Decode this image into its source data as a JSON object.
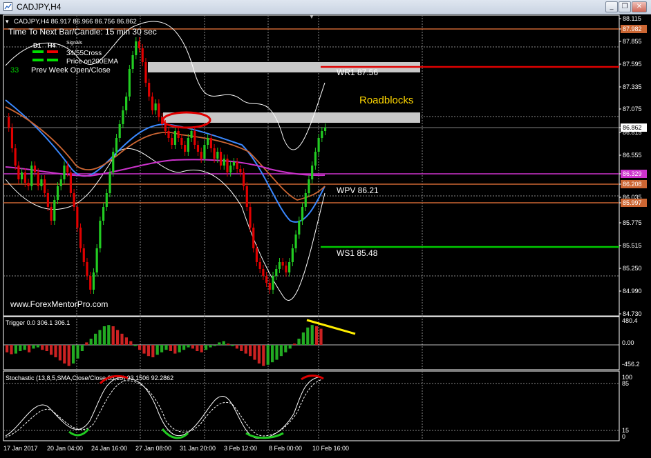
{
  "window": {
    "title": "CADJPY,H4",
    "minimize_icon": "minimize-icon",
    "restore_icon": "restore-icon",
    "close_icon": "close-icon"
  },
  "header": {
    "symbol_line": "CADJPY,H4  86.917 86.966 86.756 86.862",
    "timer": "Time To Next Bar/Candle: 15 min 30 sec",
    "signals_title": "Signals",
    "d1_label": "D1",
    "h4_label": "H4",
    "cross_label": "34/55Cross",
    "ema_label": "Price on200EMA",
    "prev_week_number": "33",
    "prev_week_label": "Prev Week Open/Close"
  },
  "annotations": {
    "wr1": "WR1   87.56",
    "wpv": "WPV   86.21",
    "ws1": "WS1   85.48",
    "roadblocks": "Roadblocks",
    "watermark": "www.ForexMentorPro.com"
  },
  "price_axis": {
    "ticks": [
      "88.115",
      "87.982",
      "87.855",
      "87.595",
      "87.335",
      "87.075",
      "86.862",
      "86.815",
      "86.555",
      "86.329",
      "86.208",
      "86.035",
      "85.997",
      "85.775",
      "85.515",
      "85.250",
      "84.990",
      "84.730"
    ],
    "current_price": "86.862",
    "badge_colors": {
      "87.982": "#cc6633",
      "86.329": "#cc33cc",
      "86.208": "#cc6633",
      "85.997": "#cc6633",
      "86.862": "#ffffff"
    }
  },
  "levels": {
    "wr1_color": "#e00000",
    "ws1_color": "#00cc00",
    "wpv_color": "#cc33cc",
    "prev_week_color": "#cc6633"
  },
  "trigger_panel": {
    "label": "Trigger 0.0 306.1 306.1",
    "ticks": [
      "480.4",
      "0.00",
      "-456.2"
    ]
  },
  "stochastic_panel": {
    "label": "Stochastic (13,8,5,SMA,Close/Close,85,15) 93.1506 92.2862",
    "ticks": [
      "100",
      "85",
      "15",
      "0"
    ]
  },
  "time_axis": {
    "labels": [
      "17 Jan 2017",
      "20 Jan 04:00",
      "24 Jan 16:00",
      "27 Jan 08:00",
      "31 Jan 20:00",
      "3 Feb 12:00",
      "8 Feb 00:00",
      "10 Feb 16:00"
    ]
  }
}
